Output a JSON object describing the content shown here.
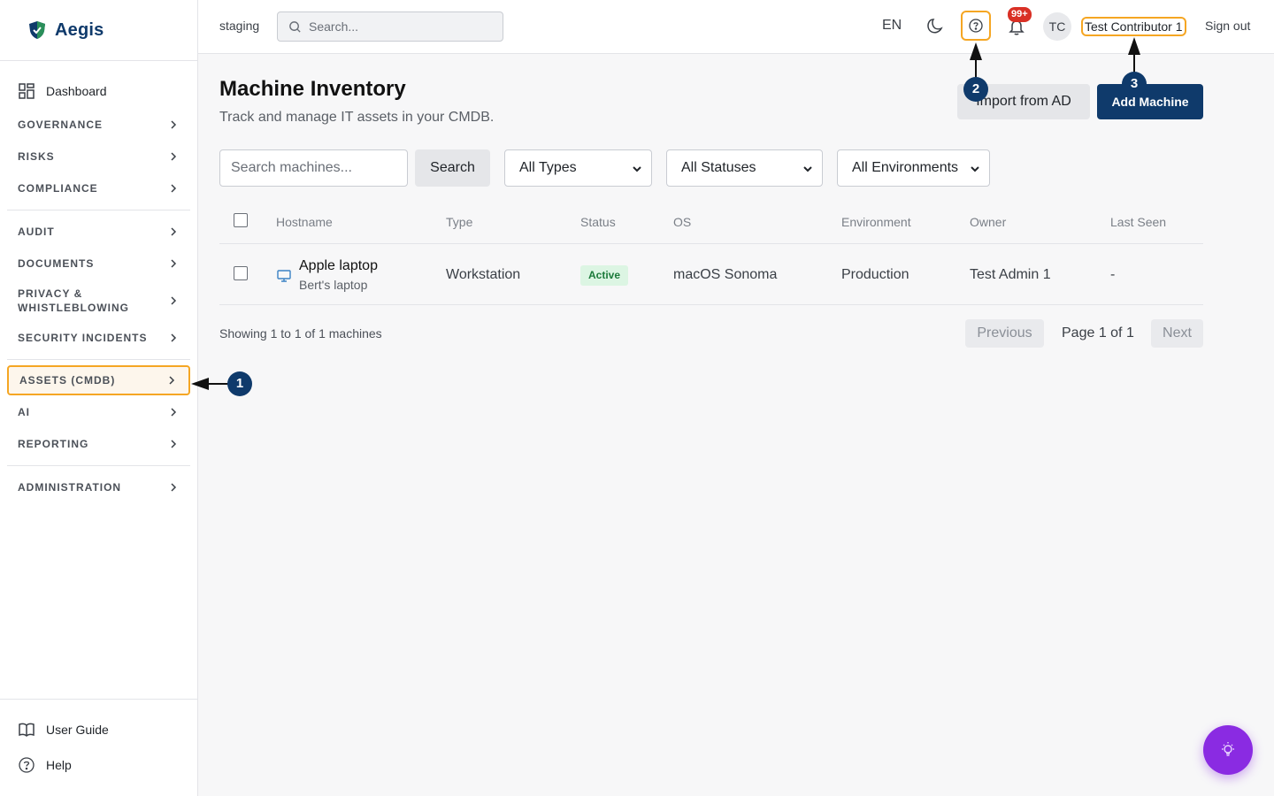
{
  "brand": {
    "name": "Aegis"
  },
  "sidebar": {
    "dashboard": "Dashboard",
    "items": [
      {
        "label": "GOVERNANCE"
      },
      {
        "label": "RISKS"
      },
      {
        "label": "COMPLIANCE"
      },
      {
        "label": "AUDIT"
      },
      {
        "label": "DOCUMENTS"
      },
      {
        "label": "PRIVACY &\nWHISTLEBLOWING"
      },
      {
        "label": "SECURITY INCIDENTS"
      },
      {
        "label": "ASSETS (CMDB)",
        "active": true
      },
      {
        "label": "AI"
      },
      {
        "label": "REPORTING"
      },
      {
        "label": "ADMINISTRATION"
      }
    ],
    "bottom": {
      "guide": "User Guide",
      "help": "Help"
    }
  },
  "header": {
    "environment": "staging",
    "search_placeholder": "Search...",
    "language": "EN",
    "notification_count": "99+",
    "avatar_initials": "TC",
    "username": "Test Contributor 1",
    "signout": "Sign out"
  },
  "page": {
    "title": "Machine Inventory",
    "subtitle": "Track and manage IT assets in your CMDB.",
    "import_label": "Import from AD",
    "add_label": "Add Machine"
  },
  "filters": {
    "search_placeholder": "Search machines...",
    "search_button": "Search",
    "type": "All Types",
    "status": "All Statuses",
    "environment": "All Environments"
  },
  "table": {
    "columns": [
      "Hostname",
      "Type",
      "Status",
      "OS",
      "Environment",
      "Owner",
      "Last Seen"
    ],
    "rows": [
      {
        "hostname": "Apple laptop",
        "description": "Bert's laptop",
        "type": "Workstation",
        "status": "Active",
        "os": "macOS Sonoma",
        "environment": "Production",
        "owner": "Test Admin 1",
        "last_seen": "-"
      }
    ]
  },
  "pagination": {
    "showing": "Showing 1 to 1 of 1 machines",
    "previous": "Previous",
    "page_label": "Page 1 of 1",
    "next": "Next"
  },
  "annotations": [
    "1",
    "2",
    "3"
  ],
  "colors": {
    "brand": "#0f3a6b",
    "highlight": "#f5a623",
    "active_status": "#1b7a3a",
    "fab": "#8a2be2",
    "badge": "#d93025"
  }
}
